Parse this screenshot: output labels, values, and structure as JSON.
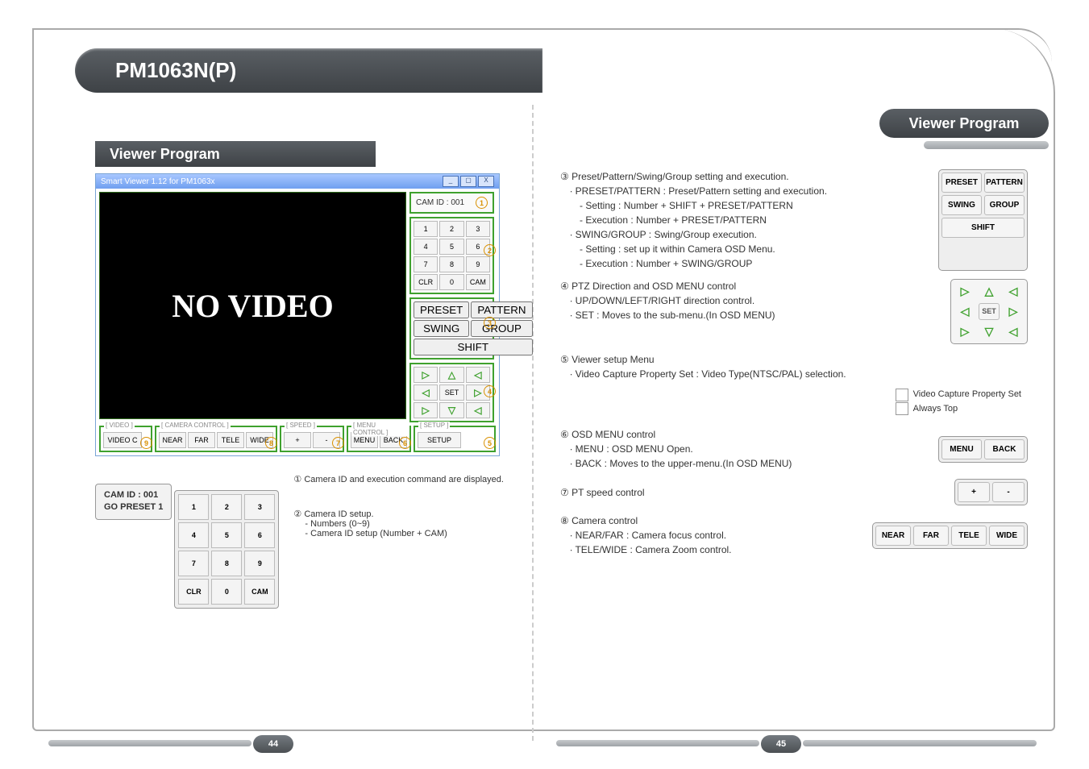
{
  "model": "PM1063N(P)",
  "viewer_label": "Viewer Program",
  "app": {
    "title": "Smart Viewer 1.12 for PM1063x",
    "no_video": "NO VIDEO",
    "cam_id_label": "CAM ID : 001",
    "keypad": [
      "1",
      "2",
      "3",
      "4",
      "5",
      "6",
      "7",
      "8",
      "9",
      "CLR",
      "0",
      "CAM"
    ],
    "preset": "PRESET",
    "pattern": "PATTERN",
    "swing": "SWING",
    "group": "GROUP",
    "shift": "SHIFT",
    "set": "SET",
    "sec_video": "[ VIDEO ]",
    "sec_camctrl": "[ CAMERA CONTROL ]",
    "sec_speed": "[ SPEED ]",
    "sec_menuctrl": "[ MENU CONTROL ]",
    "sec_setup": "[ SETUP ]",
    "video_c": "VIDEO C",
    "near": "NEAR",
    "far": "FAR",
    "tele": "TELE",
    "wide": "WIDE",
    "plus": "+",
    "minus": "-",
    "menu": "MENU",
    "back": "BACK",
    "setup": "SETUP"
  },
  "markers": {
    "m1": "1",
    "m2": "2",
    "m3": "3",
    "m4": "4",
    "m5": "5",
    "m6": "6",
    "m7": "7",
    "m8": "8",
    "m9": "9"
  },
  "info_box": {
    "l1": "CAM ID  : 001",
    "l2": "GO PRESET  1"
  },
  "kp2": [
    "1",
    "2",
    "3",
    "4",
    "5",
    "6",
    "7",
    "8",
    "9",
    "CLR",
    "0",
    "CAM"
  ],
  "n1": "① Camera ID and execution command are displayed.",
  "n2": {
    "h": "② Camera ID setup.",
    "a": "- Numbers (0~9)",
    "b": "- Camera ID setup (Number + CAM)"
  },
  "s3": {
    "h": "③ Preset/Pattern/Swing/Group setting and execution.",
    "a": "∙ PRESET/PATTERN : Preset/Pattern setting and execution.",
    "b": "- Setting : Number + SHIFT + PRESET/PATTERN",
    "c": "- Execution : Number + PRESET/PATTERN",
    "d": "∙ SWING/GROUP : Swing/Group execution.",
    "e": "- Setting : set up it within Camera OSD Menu.",
    "f": "- Execution : Number + SWING/GROUP"
  },
  "s4": {
    "h": "④ PTZ Direction and OSD MENU control",
    "a": "∙ UP/DOWN/LEFT/RIGHT direction control.",
    "b": "∙ SET : Moves to the sub-menu.(In OSD MENU)"
  },
  "s5": {
    "h": "⑤ Viewer setup Menu",
    "a": "∙  Video Capture Property Set : Video Type(NTSC/PAL) selection.",
    "m1": "Video Capture Property Set",
    "m2": "Always Top"
  },
  "s6": {
    "h": "⑥ OSD MENU control",
    "a": "∙ MENU : OSD MENU Open.",
    "b": "∙ BACK  : Moves to the upper-menu.(In OSD MENU)"
  },
  "s7": {
    "h": "⑦ PT speed control"
  },
  "s8": {
    "h": "⑧ Camera control",
    "a": "∙ NEAR/FAR : Camera focus control.",
    "b": "∙ TELE/WIDE : Camera Zoom control."
  },
  "rbtn": {
    "preset": "PRESET",
    "pattern": "PATTERN",
    "swing": "SWING",
    "group": "GROUP",
    "shift": "SHIFT",
    "set": "SET",
    "menu": "MENU",
    "back": "BACK",
    "plus": "+",
    "minus": "-",
    "near": "NEAR",
    "far": "FAR",
    "tele": "TELE",
    "wide": "WIDE"
  },
  "pages": {
    "left": "44",
    "right": "45"
  }
}
